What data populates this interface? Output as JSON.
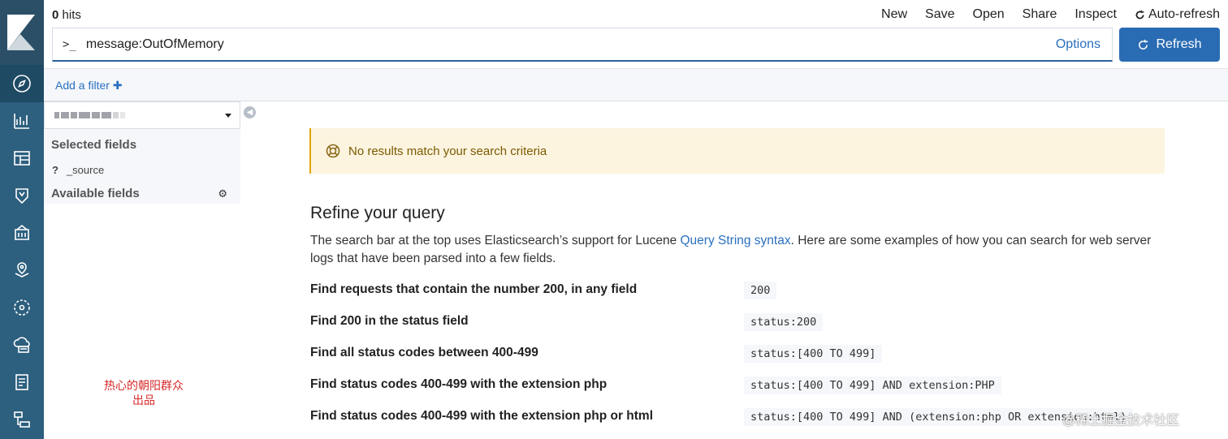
{
  "header": {
    "hits_count": "0",
    "hits_label": "hits",
    "menu": [
      "New",
      "Save",
      "Open",
      "Share",
      "Inspect"
    ],
    "auto_refresh": "Auto-refresh"
  },
  "search": {
    "prompt": ">_",
    "query": "message:OutOfMemory",
    "options": "Options",
    "refresh": "Refresh"
  },
  "filters": {
    "add": "Add a filter"
  },
  "sidebar": {
    "selected_title": "Selected fields",
    "source_type": "?",
    "source_field": "_source",
    "available_title": "Available fields"
  },
  "callout": {
    "text": "No results match your search criteria"
  },
  "refine": {
    "title": "Refine your query",
    "desc_pre": "The search bar at the top uses Elasticsearch’s support for Lucene ",
    "desc_link": "Query String syntax",
    "desc_post": ". Here are some examples of how you can search for web server logs that have been parsed into a few fields."
  },
  "examples": [
    {
      "label": "Find requests that contain the number 200, in any field",
      "code": "200"
    },
    {
      "label": "Find 200 in the status field",
      "code": "status:200"
    },
    {
      "label": "Find all status codes between 400-499",
      "code": "status:[400 TO 499]"
    },
    {
      "label": "Find status codes 400-499 with the extension php",
      "code": "status:[400 TO 499] AND extension:PHP"
    },
    {
      "label": "Find status codes 400-499 with the extension php or html",
      "code": "status:[400 TO 499] AND (extension:php OR extension:html)"
    }
  ],
  "watermarks": {
    "left_line1": "热心的朝阳群众",
    "left_line2": "出品",
    "right": "@稀土掘金技术社区"
  },
  "colors": {
    "nav": "#2d5f7e",
    "accent": "#2a6cb3",
    "callout_bg": "#fdf4e0"
  }
}
